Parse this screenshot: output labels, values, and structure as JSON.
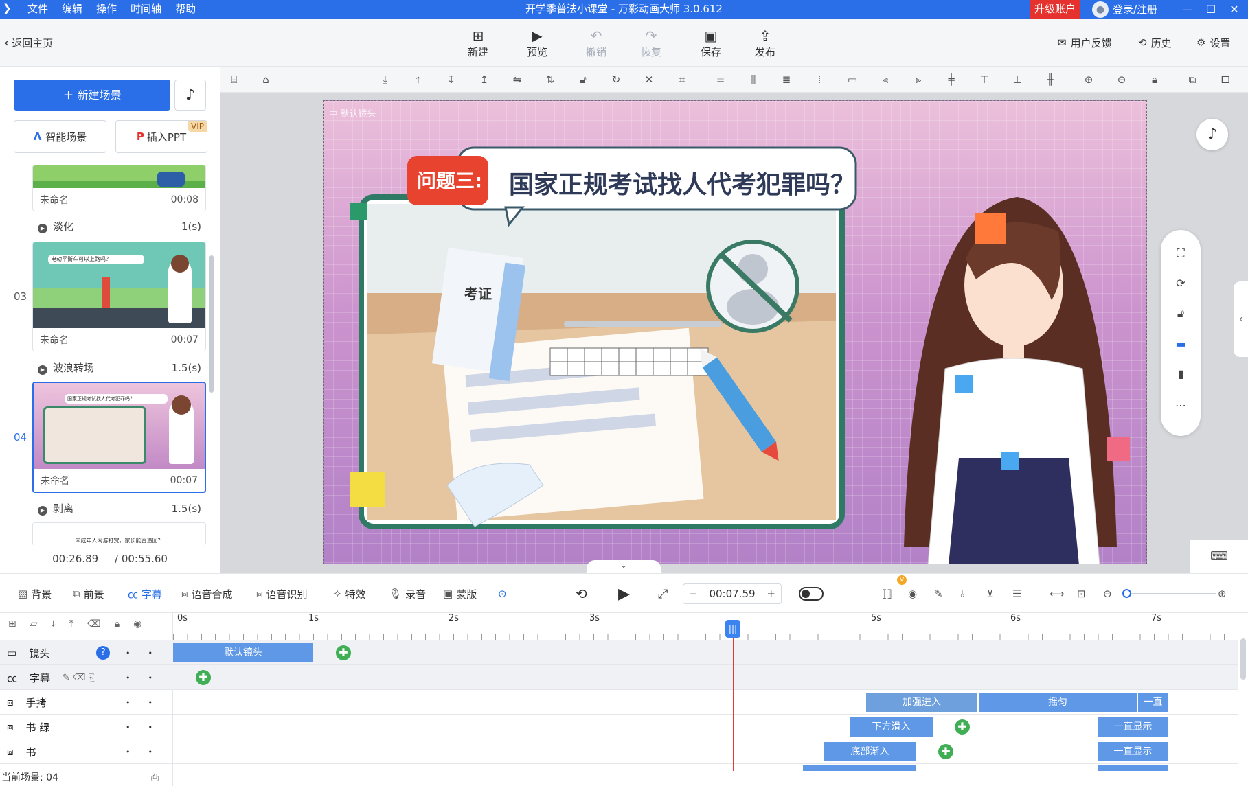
{
  "app": {
    "title": "开学季普法小课堂 - 万彩动画大师 3.0.612",
    "menu": [
      "文件",
      "编辑",
      "操作",
      "时间轴",
      "帮助"
    ],
    "upgrade": "升级账户",
    "login": "登录/注册"
  },
  "toolbar": {
    "back": "返回主页",
    "buttons": [
      {
        "label": "新建",
        "icon": "new-icon"
      },
      {
        "label": "预览",
        "icon": "preview-icon"
      },
      {
        "label": "撤销",
        "icon": "undo-icon"
      },
      {
        "label": "恢复",
        "icon": "redo-icon"
      },
      {
        "label": "保存",
        "icon": "save-icon"
      },
      {
        "label": "发布",
        "icon": "publish-icon"
      }
    ],
    "feedback": "用户反馈",
    "history": "历史",
    "settings": "设置"
  },
  "left": {
    "new_scene": "新建场景",
    "smart_scene": "智能场景",
    "insert_ppt": "插入PPT",
    "vip": "VIP",
    "scenes": [
      {
        "num": "",
        "name": "未命名",
        "duration": "00:08"
      },
      {
        "num": "03",
        "name": "未命名",
        "duration": "00:07",
        "thumb_text": "电动平衡车可以上路吗？"
      },
      {
        "num": "04",
        "name": "未命名",
        "duration": "00:07",
        "thumb_text": "国家正规考试找人代考犯罪吗？"
      }
    ],
    "transitions": [
      {
        "name": "淡化",
        "dur": "1(s)"
      },
      {
        "name": "波浪转场",
        "dur": "1.5(s)"
      },
      {
        "name": "剥离",
        "dur": "1.5(s)"
      }
    ],
    "next_thumb_text": "未成年人网游打赏，家长能否追回？",
    "current_time": "00:26.89",
    "total_time": "/ 00:55.60"
  },
  "canvas": {
    "camera_label": "默认镜头",
    "question_tag": "问题三:",
    "question": "国家正规考试找人代考犯罪吗？",
    "paper_label": "考证"
  },
  "timeline": {
    "tools": [
      {
        "label": "背景",
        "icon": "background-icon"
      },
      {
        "label": "前景",
        "icon": "foreground-icon"
      },
      {
        "label": "字幕",
        "icon": "subtitle-icon",
        "active": true
      },
      {
        "label": "语音合成",
        "icon": "tts-icon"
      },
      {
        "label": "语音识别",
        "icon": "asr-icon"
      },
      {
        "label": "特效",
        "icon": "effect-icon"
      },
      {
        "label": "录音",
        "icon": "mic-icon"
      },
      {
        "label": "蒙版",
        "icon": "mask-icon"
      }
    ],
    "time": "00:07.59",
    "minus": "−",
    "plus": "+",
    "vip_mark": "V",
    "ruler": [
      "0s",
      "1s",
      "2s",
      "3s",
      "5s",
      "6s",
      "7s"
    ],
    "tracks": [
      {
        "name": "镜头",
        "clips": [
          {
            "label": "默认镜头"
          }
        ]
      },
      {
        "name": "字幕"
      },
      {
        "name": "手拷",
        "clips": [
          {
            "label": "加强进入"
          },
          {
            "label": "摇匀"
          },
          {
            "label": "一直"
          }
        ]
      },
      {
        "name": "书 绿",
        "clips": [
          {
            "label": "下方滑入"
          },
          {
            "label": "一直显示"
          }
        ]
      },
      {
        "name": "书",
        "clips": [
          {
            "label": "底部渐入"
          },
          {
            "label": "一直显示"
          }
        ]
      }
    ],
    "status": "当前场景: 04"
  },
  "colors": {
    "accent": "#2a6ee8",
    "upgrade": "#e6322e",
    "clip": "#5f98e6",
    "keyframe": "#3fae55",
    "playhead": "#e63a3a"
  }
}
